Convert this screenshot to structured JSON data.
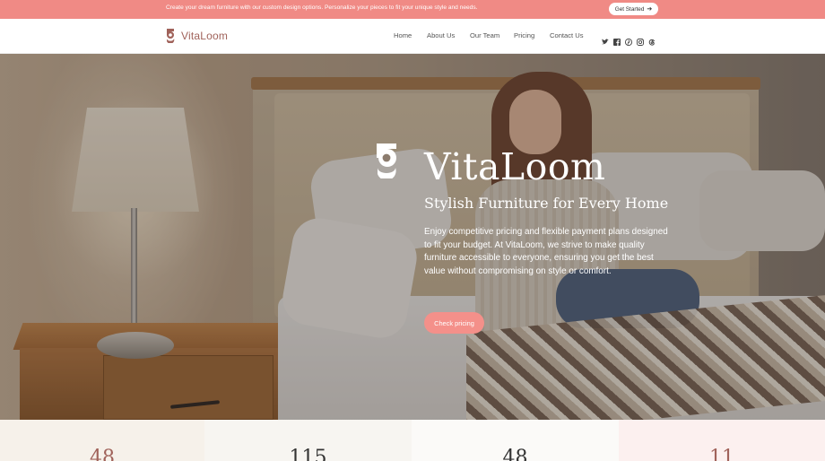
{
  "topbar": {
    "text": "Create your dream furniture with our custom design options. Personalize your pieces to fit your unique style and needs.",
    "cta_label": "Get Started",
    "cta_arrow": "➔",
    "background": "#f08a85"
  },
  "navbar": {
    "brand": "VitaLoom",
    "links": [
      "Home",
      "About Us",
      "Our Team",
      "Pricing",
      "Contact Us"
    ],
    "social_icons": [
      "twitter-icon",
      "facebook-icon",
      "pinterest-icon",
      "instagram-icon",
      "threads-icon"
    ]
  },
  "hero": {
    "title": "VitaLoom",
    "subtitle": "Stylish Furniture for Every Home",
    "body": "Enjoy competitive pricing and flexible payment plans designed to fit your budget. At VitaLoom, we strive to make quality furniture accessible to everyone, ensuring you get the best value without compromising on style or comfort.",
    "cta_label": "Check pricing",
    "accent": "#f4908a"
  },
  "stats": [
    {
      "value": "48",
      "color": "#a0625a",
      "background": "#f6f1ea"
    },
    {
      "value": "115",
      "color": "#333333",
      "background": "#f7f5f1"
    },
    {
      "value": "48",
      "color": "#333333",
      "background": "#fbfaf8"
    },
    {
      "value": "11",
      "color": "#a0625a",
      "background": "#fcf0ef"
    }
  ],
  "colors": {
    "brand": "#a0625a",
    "accent": "#f08a85"
  }
}
